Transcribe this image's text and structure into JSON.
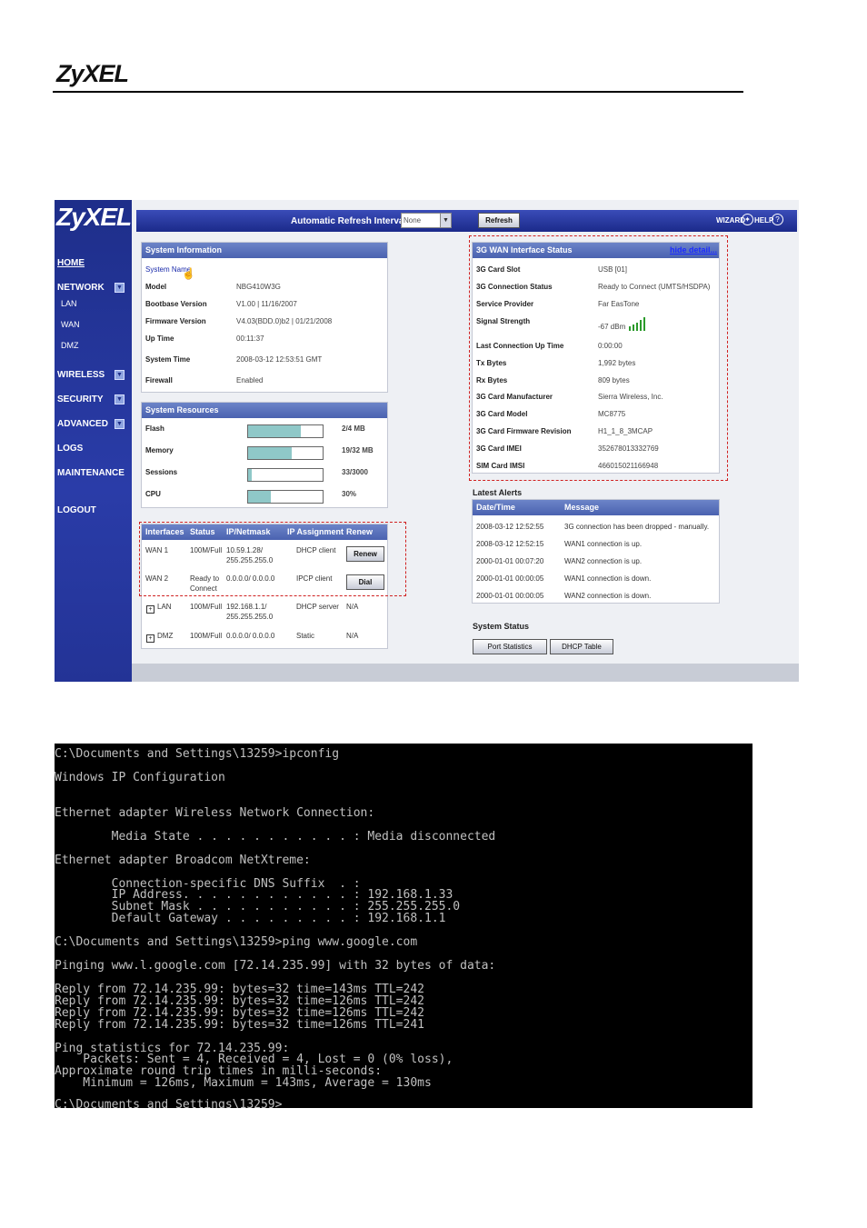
{
  "doc": {
    "logo": "ZyXEL"
  },
  "ui": {
    "logo": "ZyXEL",
    "nav": [
      {
        "label": "HOME"
      },
      {
        "label": "NETWORK"
      },
      {
        "label": "LAN"
      },
      {
        "label": "WAN"
      },
      {
        "label": "DMZ"
      },
      {
        "label": "WIRELESS"
      },
      {
        "label": "SECURITY"
      },
      {
        "label": "ADVANCED"
      },
      {
        "label": "LOGS"
      },
      {
        "label": "MAINTENANCE"
      },
      {
        "label": "LOGOUT"
      }
    ],
    "toolbar": {
      "refresh_interval_label": "Automatic Refresh Interval",
      "refresh_interval_value": "None",
      "refresh_button": "Refresh",
      "wizard": "WIZARD",
      "help": "HELP"
    },
    "system_info": {
      "title": "System Information",
      "rows": [
        {
          "label": "System Name",
          "value": ""
        },
        {
          "label": "Model",
          "value": "NBG410W3G"
        },
        {
          "label": "Bootbase Version",
          "value": "V1.00 | 11/16/2007"
        },
        {
          "label": "Firmware Version",
          "value": "V4.03(BDD.0)b2 | 01/21/2008"
        },
        {
          "label": "Up Time",
          "value": "00:11:37"
        },
        {
          "label": "System Time",
          "value": "2008-03-12 12:53:51 GMT"
        },
        {
          "label": "Firewall",
          "value": "Enabled"
        }
      ]
    },
    "system_resources": {
      "title": "System Resources",
      "rows": [
        {
          "label": "Flash",
          "value": "2/4 MB",
          "fill": 0.71
        },
        {
          "label": "Memory",
          "value": "19/32 MB",
          "fill": 0.58
        },
        {
          "label": "Sessions",
          "value": "33/3000",
          "fill": 0.05
        },
        {
          "label": "CPU",
          "value": "30%",
          "fill": 0.3
        }
      ]
    },
    "interfaces": {
      "headers": [
        "Interfaces",
        "Status",
        "IP/Netmask",
        "IP Assignment",
        "Renew"
      ],
      "rows": [
        {
          "name": "WAN 1",
          "status": "100M/Full",
          "ip": "10.59.1.28/\n255.255.255.0",
          "assign": "DHCP client",
          "action": "Renew"
        },
        {
          "name": "WAN 2",
          "status": "Ready to\nConnect",
          "ip": "0.0.0.0/ 0.0.0.0",
          "assign": "IPCP client",
          "action": "Dial"
        },
        {
          "name": "LAN",
          "status": "100M/Full",
          "ip": "192.168.1.1/\n255.255.255.0",
          "assign": "DHCP server",
          "action": "N/A"
        },
        {
          "name": "DMZ",
          "status": "100M/Full",
          "ip": "0.0.0.0/ 0.0.0.0",
          "assign": "Static",
          "action": "N/A"
        }
      ]
    },
    "wan3g": {
      "title": "3G WAN Interface Status",
      "link": "hide detail...",
      "rows": [
        {
          "label": "3G Card Slot",
          "value": "USB [01]"
        },
        {
          "label": "3G Connection Status",
          "value": "Ready to Connect (UMTS/HSDPA)"
        },
        {
          "label": "Service Provider",
          "value": "Far EasTone"
        },
        {
          "label": "Signal Strength",
          "value": "-67 dBm"
        },
        {
          "label": "Last Connection Up Time",
          "value": "0:00:00"
        },
        {
          "label": "Tx Bytes",
          "value": "1,992 bytes"
        },
        {
          "label": "Rx Bytes",
          "value": "809 bytes"
        },
        {
          "label": "3G Card Manufacturer",
          "value": "Sierra Wireless, Inc."
        },
        {
          "label": "3G Card Model",
          "value": "MC8775"
        },
        {
          "label": "3G Card Firmware Revision",
          "value": "H1_1_8_3MCAP"
        },
        {
          "label": "3G Card IMEI",
          "value": "352678013332769"
        },
        {
          "label": "SIM Card IMSI",
          "value": "466015021166948"
        }
      ]
    },
    "alerts": {
      "title": "Latest Alerts",
      "headers": [
        "Date/Time",
        "Message"
      ],
      "rows": [
        {
          "time": "2008-03-12 12:52:55",
          "msg": "3G connection has been dropped - manually."
        },
        {
          "time": "2008-03-12 12:52:15",
          "msg": "WAN1 connection is up."
        },
        {
          "time": "2000-01-01 00:07:20",
          "msg": "WAN2 connection is up."
        },
        {
          "time": "2000-01-01 00:00:05",
          "msg": "WAN1 connection is down."
        },
        {
          "time": "2000-01-01 00:00:05",
          "msg": "WAN2 connection is down."
        }
      ]
    },
    "system_status": {
      "title": "System Status",
      "port_stats": "Port Statistics",
      "dhcp_table": "DHCP Table"
    }
  },
  "terminal": {
    "lines": [
      "C:\\Documents and Settings\\13259>ipconfig",
      "",
      "Windows IP Configuration",
      "",
      "",
      "Ethernet adapter Wireless Network Connection:",
      "",
      "        Media State . . . . . . . . . . . : Media disconnected",
      "",
      "Ethernet adapter Broadcom NetXtreme:",
      "",
      "        Connection-specific DNS Suffix  . :",
      "        IP Address. . . . . . . . . . . . : 192.168.1.33",
      "        Subnet Mask . . . . . . . . . . . : 255.255.255.0",
      "        Default Gateway . . . . . . . . . : 192.168.1.1",
      "",
      "C:\\Documents and Settings\\13259>ping www.google.com",
      "",
      "Pinging www.l.google.com [72.14.235.99] with 32 bytes of data:",
      "",
      "Reply from 72.14.235.99: bytes=32 time=143ms TTL=242",
      "Reply from 72.14.235.99: bytes=32 time=126ms TTL=242",
      "Reply from 72.14.235.99: bytes=32 time=126ms TTL=242",
      "Reply from 72.14.235.99: bytes=32 time=126ms TTL=241",
      "",
      "Ping statistics for 72.14.235.99:",
      "    Packets: Sent = 4, Received = 4, Lost = 0 (0% loss),",
      "Approximate round trip times in milli-seconds:",
      "    Minimum = 126ms, Maximum = 143ms, Average = 130ms",
      "",
      "C:\\Documents and Settings\\13259>"
    ]
  }
}
